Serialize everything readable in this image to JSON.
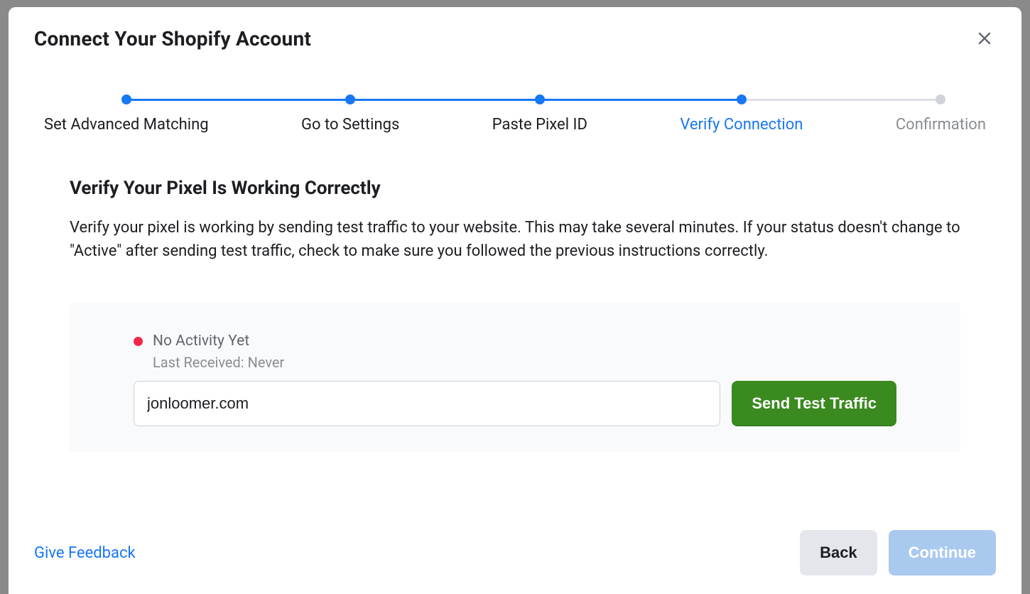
{
  "header": {
    "title": "Connect Your Shopify Account"
  },
  "stepper": {
    "steps": [
      {
        "label": "Set Advanced Matching",
        "state": "done"
      },
      {
        "label": "Go to Settings",
        "state": "done"
      },
      {
        "label": "Paste Pixel ID",
        "state": "done"
      },
      {
        "label": "Verify Connection",
        "state": "active"
      },
      {
        "label": "Confirmation",
        "state": "future"
      }
    ]
  },
  "main": {
    "section_title": "Verify Your Pixel Is Working Correctly",
    "section_desc": "Verify your pixel is working by sending test traffic to your website. This may take several minutes. If your status doesn't change to \"Active\" after sending test traffic, check to make sure you followed the previous instructions correctly.",
    "status": {
      "dot_color": "#f02849",
      "text": "No Activity Yet",
      "subtext": "Last Received: Never"
    },
    "url_value": "jonloomer.com",
    "send_label": "Send Test Traffic"
  },
  "footer": {
    "feedback": "Give Feedback",
    "back": "Back",
    "continue": "Continue"
  }
}
